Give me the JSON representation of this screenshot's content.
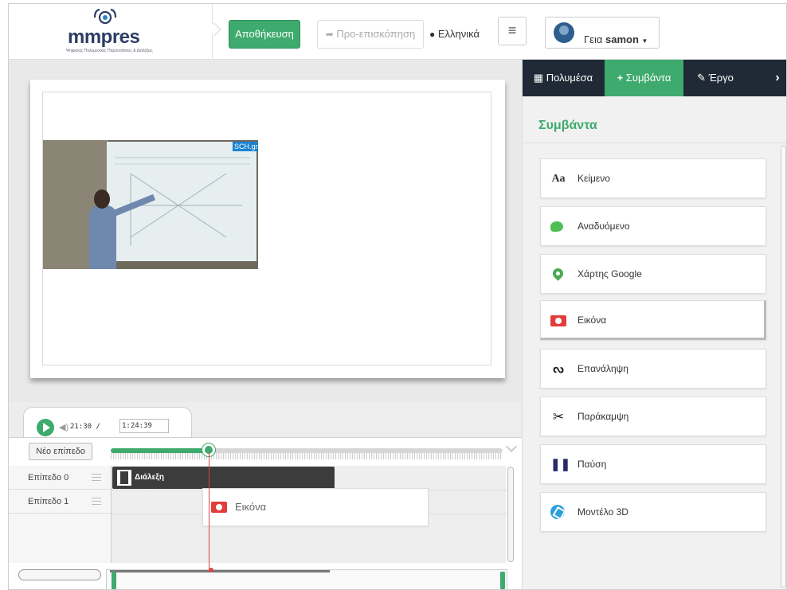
{
  "header": {
    "logo_text": "mmpres",
    "logo_tagline": "Ψηφιακές Πολυμεσικές Παρουσιάσεις & Διαλέξεις",
    "save_label": "Αποθήκευση",
    "preview_label": "Προ-επισκόπηση",
    "language_label": "Ελληνικά",
    "greeting": "Γεια",
    "username": "samon"
  },
  "slide": {
    "video_badge": "SCH.gr"
  },
  "timeline": {
    "current_time": "21:30",
    "separator": "/",
    "total_time": "1:24:39",
    "progress_fraction": 0.25,
    "new_layer_label": "Νέο επίπεδο",
    "layers": [
      {
        "label": "Επίπεδο 0"
      },
      {
        "label": "Επίπεδο 1"
      }
    ],
    "clips": {
      "lecture_label": "Διάλεξη",
      "image_label": "Εικόνα"
    }
  },
  "panel": {
    "tabs": {
      "media": "Πολυμέσα",
      "events": "Συμβάντα",
      "project": "Έργο"
    },
    "title": "Συμβάντα",
    "items": [
      {
        "label": "Κείμενο",
        "icon": "text-icon"
      },
      {
        "label": "Αναδυόμενο",
        "icon": "speech-bubble-icon"
      },
      {
        "label": "Χάρτης Google",
        "icon": "map-pin-icon"
      },
      {
        "label": "Εικόνα",
        "icon": "camera-icon"
      },
      {
        "label": "Επανάληψη",
        "icon": "loop-icon"
      },
      {
        "label": "Παράκαμψη",
        "icon": "scissors-icon"
      },
      {
        "label": "Παύση",
        "icon": "pause-icon"
      },
      {
        "label": "Μοντέλο 3D",
        "icon": "cube-icon"
      }
    ]
  },
  "colors": {
    "accent": "#3eaa6d",
    "panel_tabs_bg": "#1f2a36",
    "playhead": "#dd4444"
  }
}
